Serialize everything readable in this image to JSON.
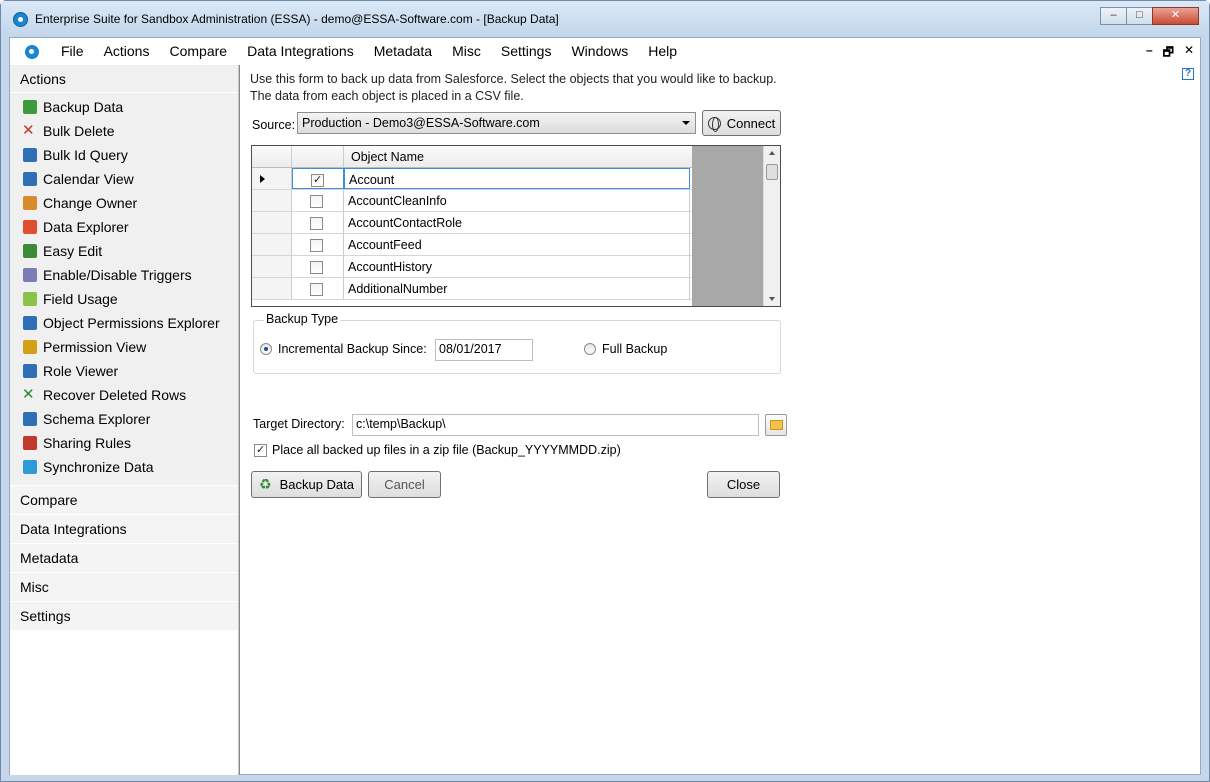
{
  "window": {
    "title": "Enterprise Suite for Sandbox Administration (ESSA) - demo@ESSA-Software.com - [Backup Data]",
    "minimize_glyph": "–",
    "maximize_glyph": "□",
    "close_glyph": "✕"
  },
  "menu": {
    "items": [
      "File",
      "Actions",
      "Compare",
      "Data Integrations",
      "Metadata",
      "Misc",
      "Settings",
      "Windows",
      "Help"
    ],
    "mdi_minimize": "–",
    "mdi_restore": "🗗",
    "mdi_close": "✕"
  },
  "sidebar": {
    "header": "Actions",
    "items": [
      {
        "label": "Backup Data",
        "icon": "backup-icon"
      },
      {
        "label": "Bulk Delete",
        "icon": "delete-x-icon"
      },
      {
        "label": "Bulk Id Query",
        "icon": "query-icon"
      },
      {
        "label": "Calendar View",
        "icon": "calendar-icon"
      },
      {
        "label": "Change Owner",
        "icon": "change-owner-icon"
      },
      {
        "label": "Data Explorer",
        "icon": "data-explorer-icon"
      },
      {
        "label": "Easy Edit",
        "icon": "easy-edit-icon"
      },
      {
        "label": "Enable/Disable Triggers",
        "icon": "triggers-icon"
      },
      {
        "label": "Field Usage",
        "icon": "field-usage-icon"
      },
      {
        "label": "Object Permissions Explorer",
        "icon": "object-permissions-icon"
      },
      {
        "label": "Permission View",
        "icon": "permission-view-icon"
      },
      {
        "label": "Role Viewer",
        "icon": "role-viewer-icon"
      },
      {
        "label": "Recover Deleted Rows",
        "icon": "recover-icon"
      },
      {
        "label": "Schema Explorer",
        "icon": "schema-icon"
      },
      {
        "label": "Sharing Rules",
        "icon": "sharing-rules-icon"
      },
      {
        "label": "Synchronize Data",
        "icon": "synchronize-icon"
      }
    ],
    "groups": [
      "Compare",
      "Data Integrations",
      "Metadata",
      "Misc",
      "Settings"
    ]
  },
  "main": {
    "help_glyph": "?",
    "intro": "Use this form to back up data from Salesforce. Select the objects that you would like to backup. The data from each object is placed in a CSV file.",
    "source_label": "Source:",
    "source_value": "Production - Demo3@ESSA-Software.com",
    "connect_label": "Connect",
    "grid": {
      "column_header": "Object Name",
      "rows": [
        {
          "name": "Account",
          "checked": true
        },
        {
          "name": "AccountCleanInfo",
          "checked": false
        },
        {
          "name": "AccountContactRole",
          "checked": false
        },
        {
          "name": "AccountFeed",
          "checked": false
        },
        {
          "name": "AccountHistory",
          "checked": false
        },
        {
          "name": "AdditionalNumber",
          "checked": false
        }
      ]
    },
    "backup_type": {
      "legend": "Backup Type",
      "incremental_label": "Incremental Backup Since:",
      "incremental_date": "08/01/2017",
      "full_label": "Full Backup",
      "selected": "incremental"
    },
    "target_label": "Target Directory:",
    "target_value": "c:\\temp\\Backup\\",
    "zip_label": "Place all backed up files in a zip file (Backup_YYYYMMDD.zip)",
    "zip_checked": true,
    "buttons": {
      "backup": "Backup Data",
      "cancel": "Cancel",
      "close": "Close"
    }
  }
}
